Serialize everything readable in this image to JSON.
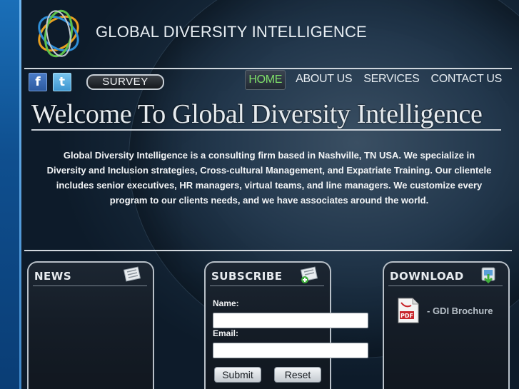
{
  "site": {
    "title": "GLOBAL DIVERSITY INTELLIGENCE"
  },
  "social": {
    "facebook_icon": "facebook-icon",
    "twitter_icon": "twitter-icon"
  },
  "survey_label": "SURVEY",
  "nav": [
    {
      "label": "HOME",
      "active": true
    },
    {
      "label": "ABOUT US",
      "active": false
    },
    {
      "label": "SERVICES",
      "active": false
    },
    {
      "label": "CONTACT US",
      "active": false
    }
  ],
  "welcome": "Welcome To Global Diversity Intelligence",
  "intro": "Global Diversity Intelligence is a consulting firm based in Nashville, TN USA. We specialize in Diversity and Inclusion strategies, Cross-cultural Management, and Expatriate Training. Our clientele includes senior executives, HR managers, virtual teams, and line managers. We customize every program to our clients needs, and we have associates around the world.",
  "panels": {
    "news": {
      "title": "NEWS",
      "icon": "newspaper-icon"
    },
    "subscribe": {
      "title": "SUBSCRIBE",
      "icon": "newspaper-add-icon",
      "name_label": "Name:",
      "email_label": "Email:",
      "name_value": "",
      "email_value": "",
      "submit_label": "Submit",
      "reset_label": "Reset"
    },
    "download": {
      "title": "DOWNLOAD",
      "icon": "download-icon",
      "items": [
        {
          "label": "- GDI Brochure",
          "icon": "pdf-icon"
        }
      ]
    }
  },
  "colors": {
    "nav_active": "#7fe06a",
    "left_band": "#1a6fb8",
    "background": "#142536"
  }
}
